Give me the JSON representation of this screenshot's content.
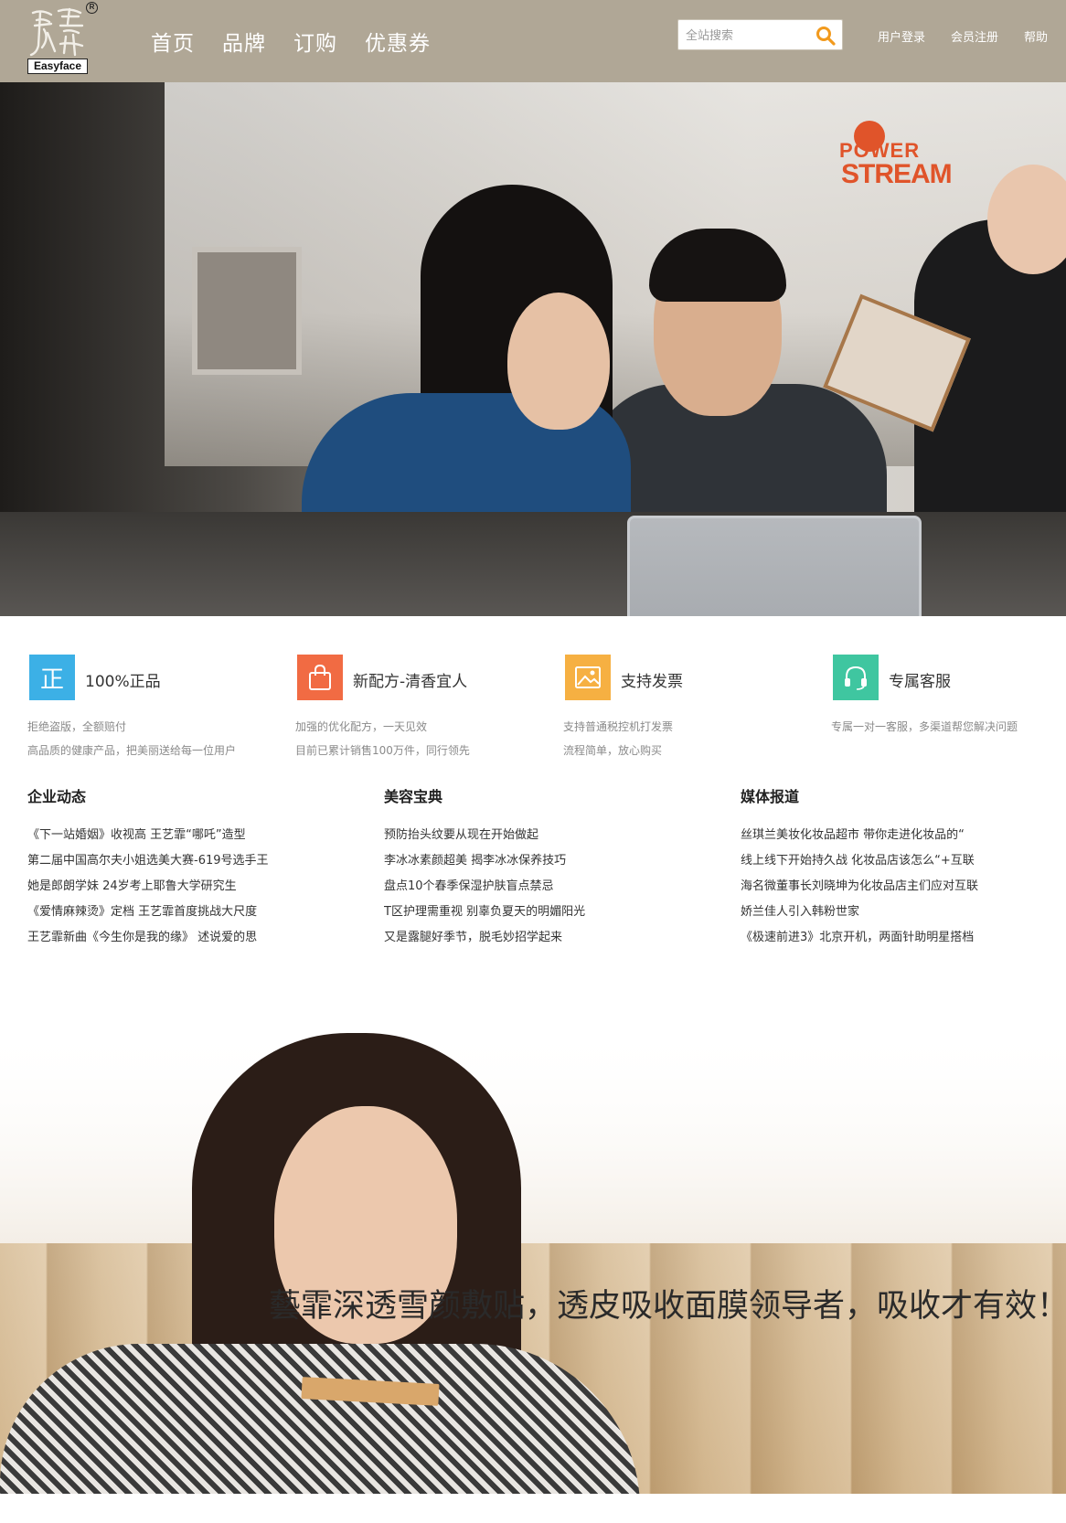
{
  "header": {
    "logo": {
      "seal_text": "藝霏",
      "brand": "Easyface",
      "registered_mark": "R"
    },
    "nav": [
      {
        "label": "首页"
      },
      {
        "label": "品牌"
      },
      {
        "label": "订购"
      },
      {
        "label": "优惠券"
      }
    ],
    "search": {
      "placeholder": "全站搜索",
      "value": ""
    },
    "user_links": [
      {
        "label": "用户登录"
      },
      {
        "label": "会员注册"
      },
      {
        "label": "帮助"
      }
    ]
  },
  "banner": {
    "sign_power": "POWER",
    "sign_stream": "STREAM",
    "slide_count": 3,
    "active_slide": 2
  },
  "features": [
    {
      "icon": "authentic-icon",
      "icon_glyph": "正",
      "color": "#3cb0e6",
      "title": "100%正品",
      "desc": [
        "拒绝盗版，全额赔付",
        "高品质的健康产品，把美丽送给每一位用户"
      ]
    },
    {
      "icon": "bag-icon",
      "color": "#f16b43",
      "title": "新配方-清香宜人",
      "desc": [
        "加强的优化配方，一天见效",
        "目前已累计销售100万件，同行领先"
      ]
    },
    {
      "icon": "invoice-icon",
      "color": "#f6b042",
      "title": "支持发票",
      "desc": [
        "支持普通税控机打发票",
        "流程简单，放心购买"
      ]
    },
    {
      "icon": "headset-icon",
      "color": "#3fc6a0",
      "title": "专属客服",
      "desc": [
        "专属一对一客服，多渠道帮您解决问题"
      ]
    }
  ],
  "news": [
    {
      "title": "企业动态",
      "items": [
        "《下一站婚姻》收视高 王艺霏“哪吒”造型",
        "第二届中国高尔夫小姐选美大赛-619号选手王",
        "她是郎朗学妹 24岁考上耶鲁大学研究生",
        "《爱情麻辣烫》定档 王艺霏首度挑战大尺度",
        "王艺霏新曲《今生你是我的缘》 述说爱的思"
      ]
    },
    {
      "title": "美容宝典",
      "items": [
        "预防抬头纹要从现在开始做起",
        "李冰冰素颜超美 揭李冰冰保养技巧",
        "盘点10个春季保湿护肤盲点禁忌",
        "T区护理需重视 别辜负夏天的明媚阳光",
        "又是露腿好季节，脱毛妙招学起来"
      ]
    },
    {
      "title": "媒体报道",
      "items": [
        "丝琪兰美妆化妆品超市 带你走进化妆品的“",
        "线上线下开始持久战 化妆品店该怎么“+互联",
        "海名微董事长刘晓坤为化妆品店主们应对互联",
        "娇兰佳人引入韩粉世家",
        "《极速前进3》北京开机，两面针助明星搭档"
      ]
    }
  ],
  "promo": {
    "slogan": "藝霏深透雪颜敷贴，透皮吸收面膜领导者，吸收才有效！"
  }
}
